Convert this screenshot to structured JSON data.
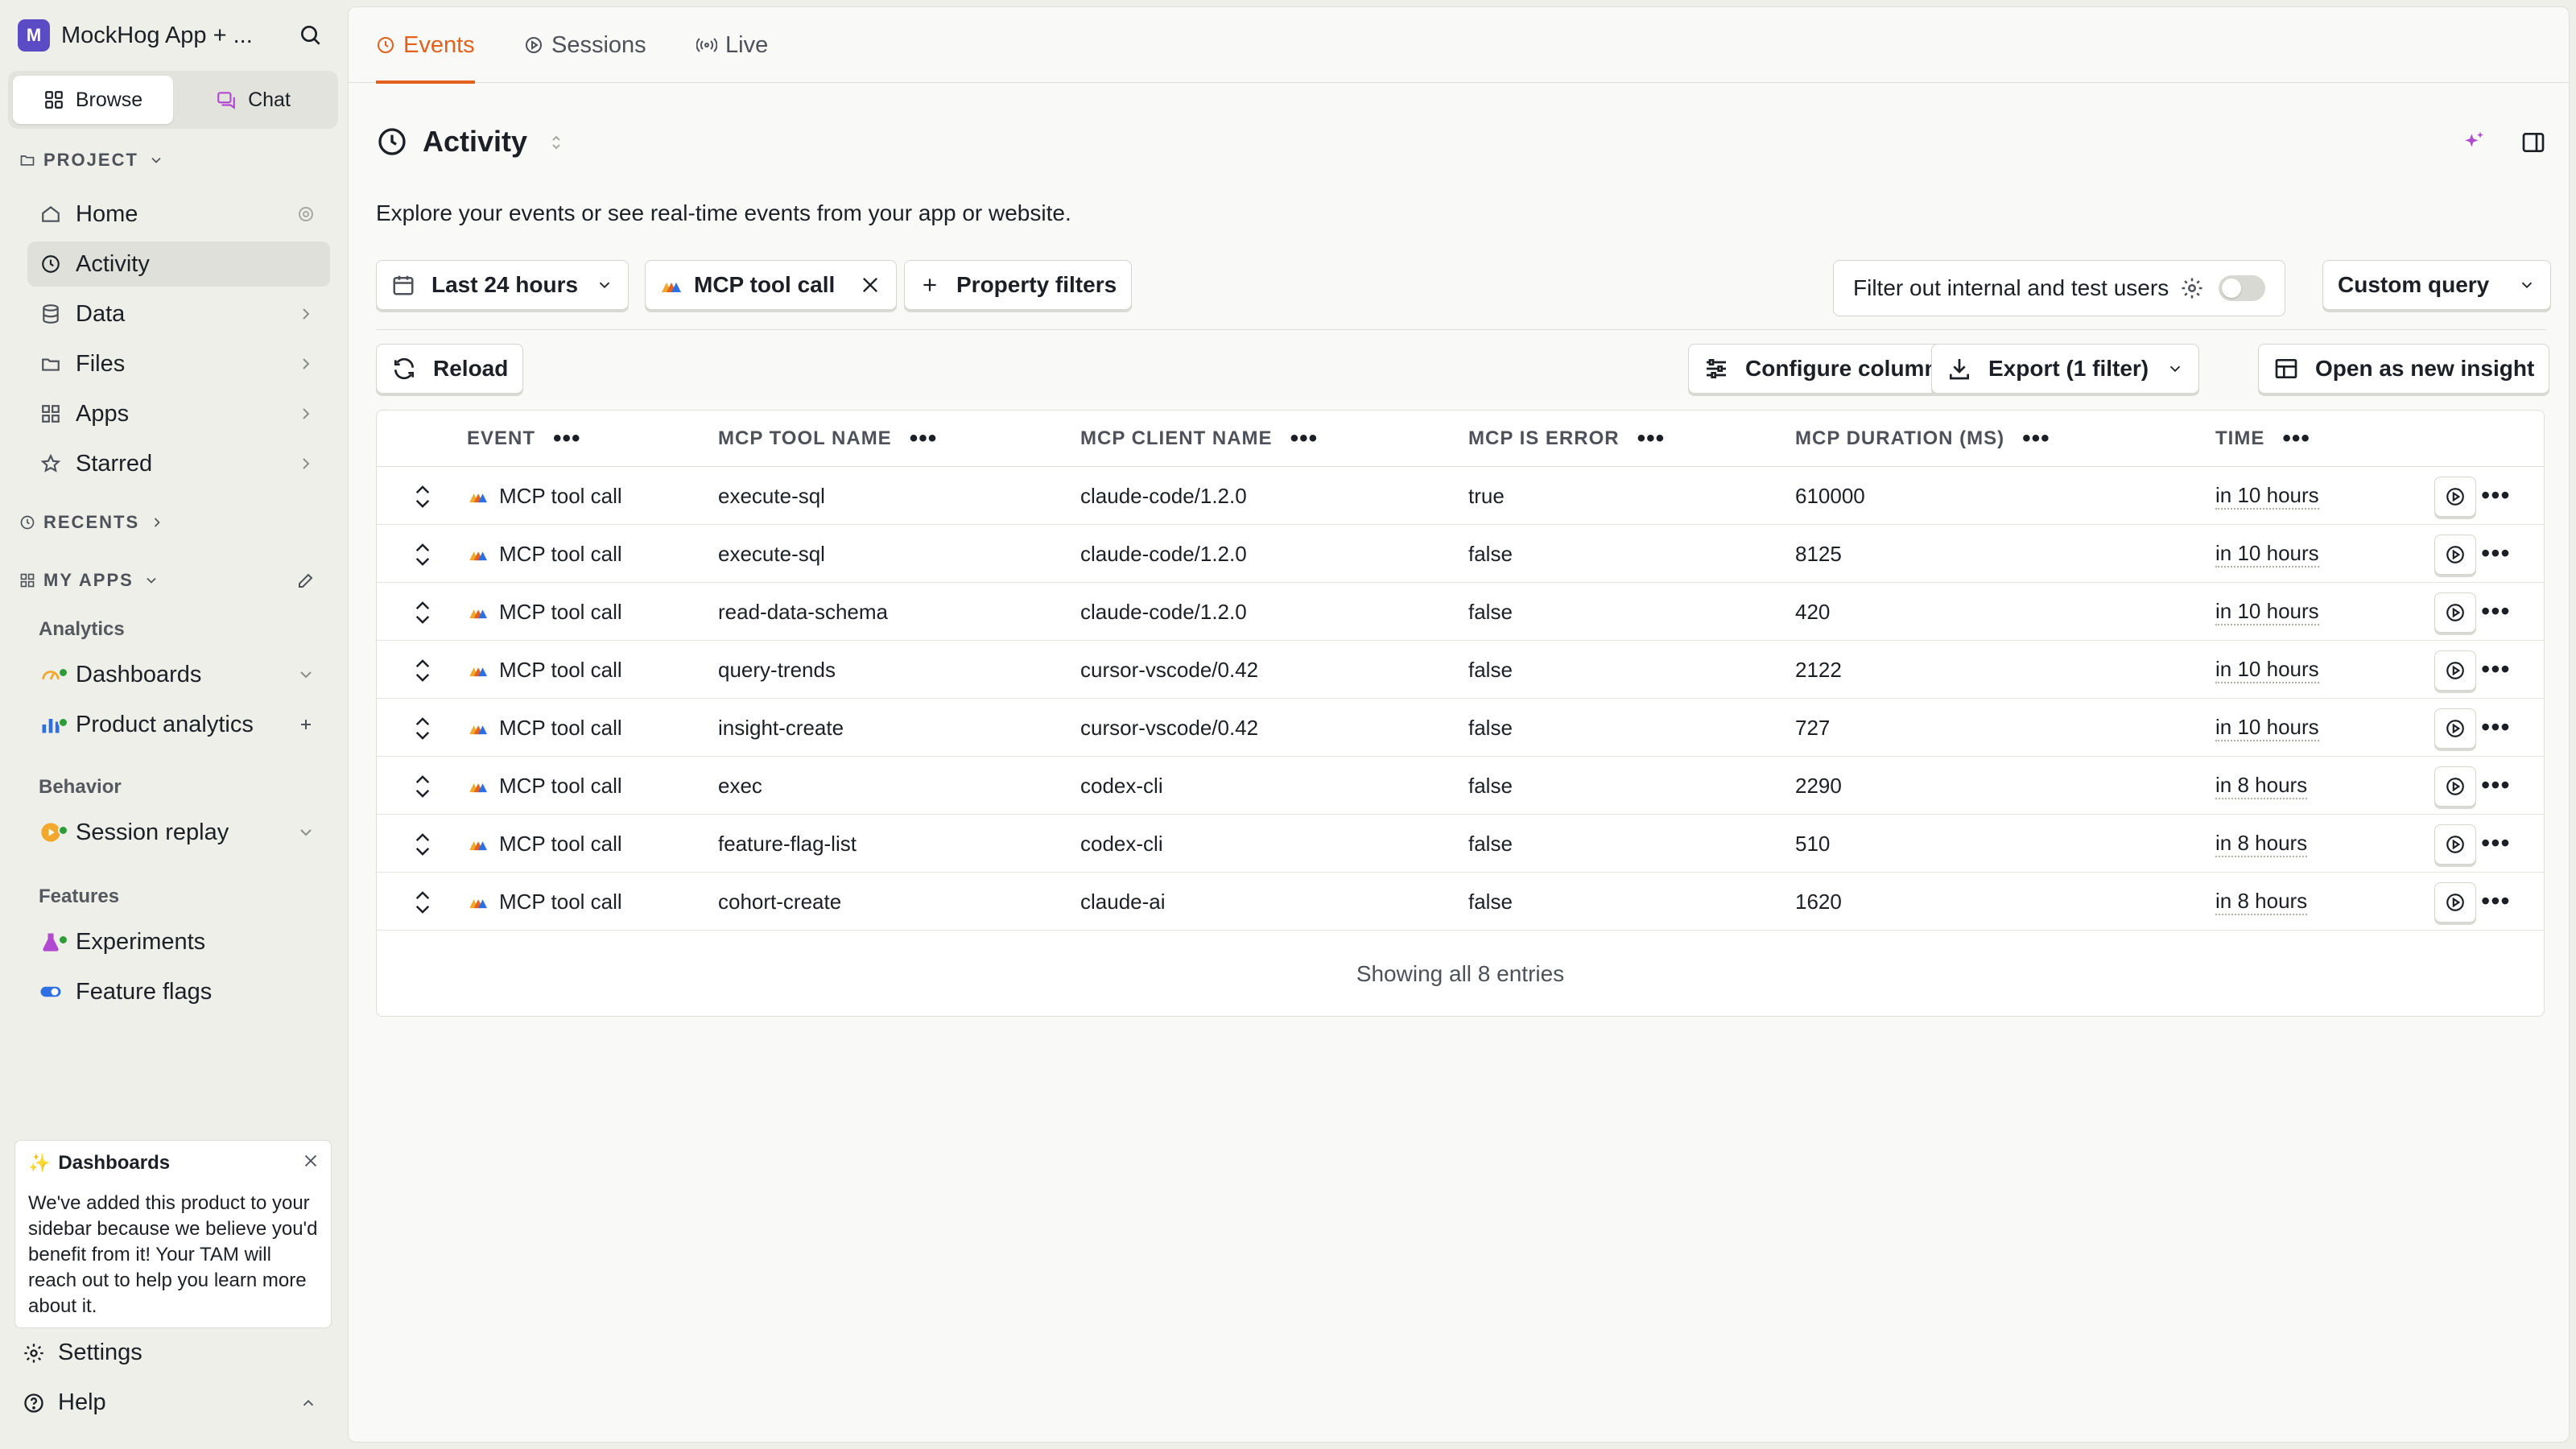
{
  "sidebar": {
    "workspace_initial": "M",
    "workspace_name": "MockHog App + ...",
    "seg_browse": "Browse",
    "seg_chat": "Chat",
    "project_label": "PROJECT",
    "nav": {
      "home": "Home",
      "activity": "Activity",
      "data": "Data",
      "files": "Files",
      "apps": "Apps",
      "starred": "Starred"
    },
    "recents_label": "RECENTS",
    "myapps_label": "MY APPS",
    "cat_analytics": "Analytics",
    "dashboards": "Dashboards",
    "product_analytics": "Product analytics",
    "cat_behavior": "Behavior",
    "session_replay": "Session replay",
    "cat_features": "Features",
    "experiments": "Experiments",
    "feature_flags": "Feature flags",
    "promo": {
      "title": "Dashboards",
      "body": "We've added this product to your sidebar because we believe you'd benefit from it! Your TAM will reach out to help you learn more about it."
    },
    "settings": "Settings",
    "help": "Help"
  },
  "tabs": {
    "events": "Events",
    "sessions": "Sessions",
    "live": "Live"
  },
  "page": {
    "title": "Activity",
    "description": "Explore your events or see real-time events from your app or website."
  },
  "filters": {
    "date_range": "Last 24 hours",
    "event_filter": "MCP tool call",
    "property_filters": "Property filters",
    "internal_users": "Filter out internal and test users",
    "custom_query": "Custom query"
  },
  "actions": {
    "reload": "Reload",
    "configure_columns": "Configure columns",
    "export": "Export (1 filter)",
    "open_insight": "Open as new insight"
  },
  "table": {
    "columns": [
      "EVENT",
      "MCP TOOL NAME",
      "MCP CLIENT NAME",
      "MCP IS ERROR",
      "MCP DURATION (MS)",
      "TIME"
    ],
    "rows": [
      {
        "event": "MCP tool call",
        "tool": "execute-sql",
        "client": "claude-code/1.2.0",
        "error": "true",
        "duration": "610000",
        "time": "in 10 hours"
      },
      {
        "event": "MCP tool call",
        "tool": "execute-sql",
        "client": "claude-code/1.2.0",
        "error": "false",
        "duration": "8125",
        "time": "in 10 hours"
      },
      {
        "event": "MCP tool call",
        "tool": "read-data-schema",
        "client": "claude-code/1.2.0",
        "error": "false",
        "duration": "420",
        "time": "in 10 hours"
      },
      {
        "event": "MCP tool call",
        "tool": "query-trends",
        "client": "cursor-vscode/0.42",
        "error": "false",
        "duration": "2122",
        "time": "in 10 hours"
      },
      {
        "event": "MCP tool call",
        "tool": "insight-create",
        "client": "cursor-vscode/0.42",
        "error": "false",
        "duration": "727",
        "time": "in 10 hours"
      },
      {
        "event": "MCP tool call",
        "tool": "exec",
        "client": "codex-cli",
        "error": "false",
        "duration": "2290",
        "time": "in 8 hours"
      },
      {
        "event": "MCP tool call",
        "tool": "feature-flag-list",
        "client": "codex-cli",
        "error": "false",
        "duration": "510",
        "time": "in 8 hours"
      },
      {
        "event": "MCP tool call",
        "tool": "cohort-create",
        "client": "claude-ai",
        "error": "false",
        "duration": "1620",
        "time": "in 8 hours"
      }
    ],
    "footer": "Showing all 8 entries"
  },
  "colors": {
    "accent": "#e4611d",
    "brand": "#5b4bc4",
    "status_green": "#2f9c3a"
  }
}
